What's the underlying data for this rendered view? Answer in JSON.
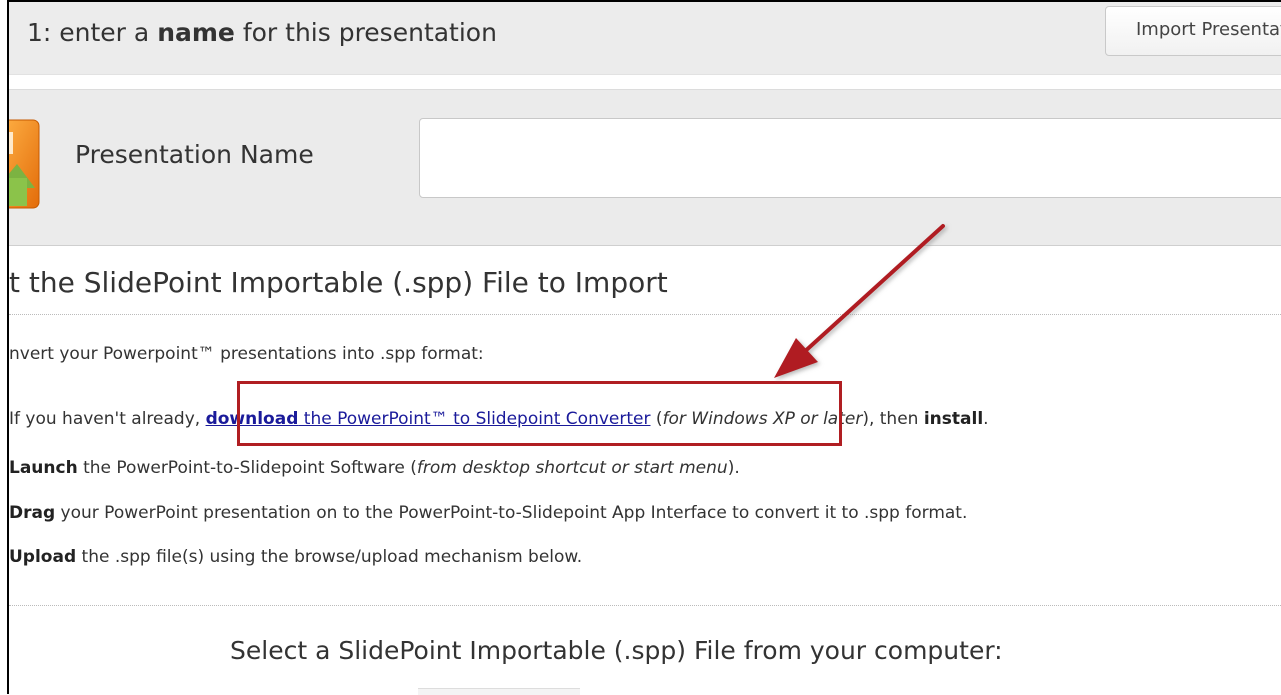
{
  "step": {
    "number": "1",
    "prefix": ": enter a ",
    "bold": "name",
    "suffix": " for this presentation",
    "import_button_label": "Import Presentation"
  },
  "name_field": {
    "label": "Presentation Name",
    "value": ""
  },
  "section": {
    "title": "t the SlidePoint Importable (.spp) File to Import",
    "lead": "nvert your Powerpoint™ presentations into .spp format:",
    "step1": {
      "pre": "If you haven't already, ",
      "link_bold": "download",
      "link_rest": " the PowerPoint™ to Slidepoint Converter",
      "paren_open": " (",
      "italic": "for Windows XP or later",
      "post": "), then ",
      "bold_end": "install",
      "dot": "."
    },
    "step2": {
      "bold": "Launch",
      "text": " the PowerPoint-to-Slidepoint Software (",
      "italic": "from desktop shortcut or start menu",
      "end": ")."
    },
    "step3": {
      "bold": "Drag",
      "text": " your PowerPoint presentation on to the PowerPoint-to-Slidepoint App Interface to convert it to .spp format."
    },
    "step4": {
      "bold": "Upload",
      "text": " the .spp file(s) using the browse/upload mechanism below."
    },
    "select_prompt": "Select a SlidePoint Importable (.spp) File from your computer:"
  },
  "colors": {
    "annotation": "#b01e22",
    "link": "#1a1a9a",
    "band": "#ebebeb"
  }
}
